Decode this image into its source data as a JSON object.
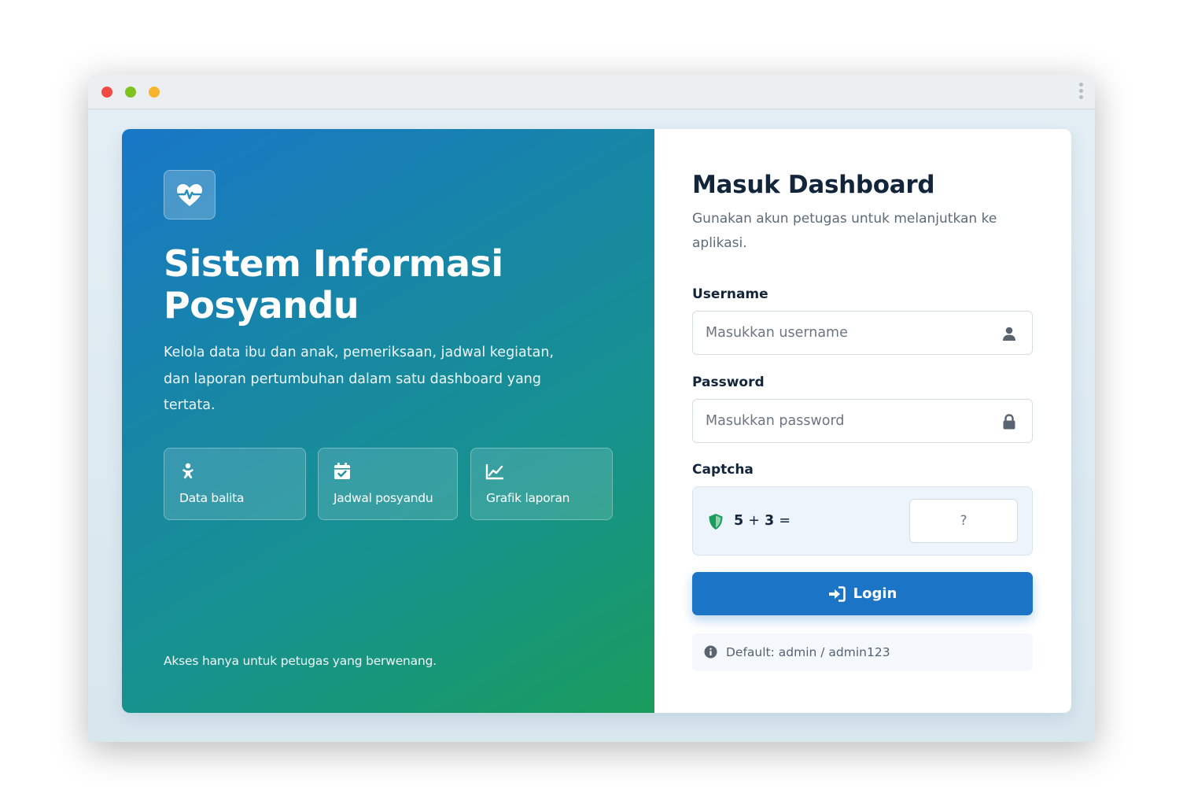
{
  "window": {
    "controls": [
      "close",
      "minimize",
      "maximize"
    ]
  },
  "hero": {
    "logo_icon": "heart-pulse-icon",
    "title_line1": "Sistem Informasi",
    "title_line2": "Posyandu",
    "description": "Kelola data ibu dan anak, pemeriksaan, jadwal kegiatan, dan laporan pertumbuhan dalam satu dashboard yang tertata.",
    "features": [
      {
        "icon": "baby-icon",
        "label": "Data balita"
      },
      {
        "icon": "calendar-check-icon",
        "label": "Jadwal posyandu"
      },
      {
        "icon": "line-chart-icon",
        "label": "Grafik laporan"
      }
    ],
    "footer": "Akses hanya untuk petugas yang berwenang."
  },
  "form": {
    "title": "Masuk Dashboard",
    "subtitle": "Gunakan akun petugas untuk melanjutkan ke aplikasi.",
    "username": {
      "label": "Username",
      "placeholder": "Masukkan username",
      "value": "",
      "icon": "user-icon"
    },
    "password": {
      "label": "Password",
      "placeholder": "Masukkan password",
      "value": "",
      "icon": "lock-icon"
    },
    "captcha": {
      "label": "Captcha",
      "icon": "shield-check-icon",
      "operand1": "5",
      "operator": "+",
      "operand2": "3",
      "equals": "=",
      "placeholder": "?",
      "value": ""
    },
    "login_button": {
      "label": "Login",
      "icon": "sign-in-icon"
    },
    "hint": {
      "icon": "info-circle-icon",
      "text": "Default: admin / admin123"
    }
  },
  "colors": {
    "primary": "#1b74c5",
    "hero_gradient_start": "#1877c7",
    "hero_gradient_end": "#1a9c5c",
    "heading": "#13253a",
    "captcha_shield": "#1a9c5c"
  }
}
